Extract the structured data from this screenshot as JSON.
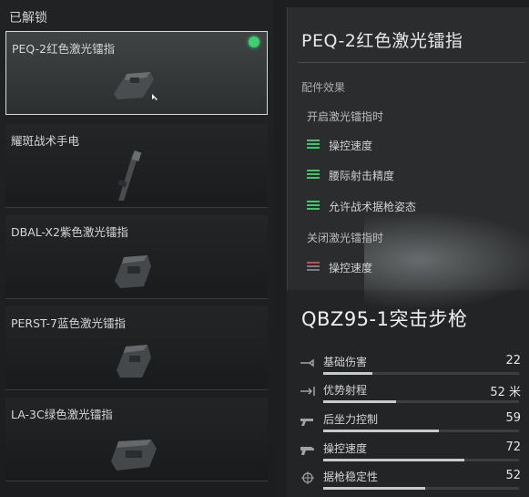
{
  "list": {
    "section_title": "已解锁",
    "items": [
      {
        "label": "PEQ-2红色激光镭指",
        "selected": true,
        "equipped": true
      },
      {
        "label": "耀斑战术手电"
      },
      {
        "label": "DBAL-X2紫色激光镭指"
      },
      {
        "label": "PERST-7蓝色激光镭指"
      },
      {
        "label": "LA-3C绿色激光镭指"
      }
    ]
  },
  "attachment": {
    "title": "PEQ-2红色激光镭指",
    "effects_header": "配件效果",
    "on_condition": "开启激光镭指时",
    "on_effects": [
      "操控速度",
      "腰际射击精度",
      "允许战术据枪姿态"
    ],
    "off_condition": "关闭激光镭指时",
    "off_effects": [
      "操控速度"
    ]
  },
  "weapon": {
    "title": "QBZ95-1突击步枪",
    "stats": [
      {
        "name": "基础伤害",
        "value": "22",
        "fill": 0.25,
        "icon": "bullet-icon"
      },
      {
        "name": "优势射程",
        "value": "52 米",
        "fill": 0.37,
        "icon": "range-icon"
      },
      {
        "name": "后坐力控制",
        "value": "59",
        "fill": 0.59,
        "icon": "recoil-icon"
      },
      {
        "name": "操控速度",
        "value": "72",
        "fill": 0.72,
        "icon": "handling-icon"
      },
      {
        "name": "据枪稳定性",
        "value": "52",
        "fill": 0.52,
        "icon": "crosshair-icon"
      }
    ]
  },
  "colors": {
    "equipped": "#3ecf72",
    "buff": "#42c46a",
    "debuff": "#c94a4a"
  }
}
